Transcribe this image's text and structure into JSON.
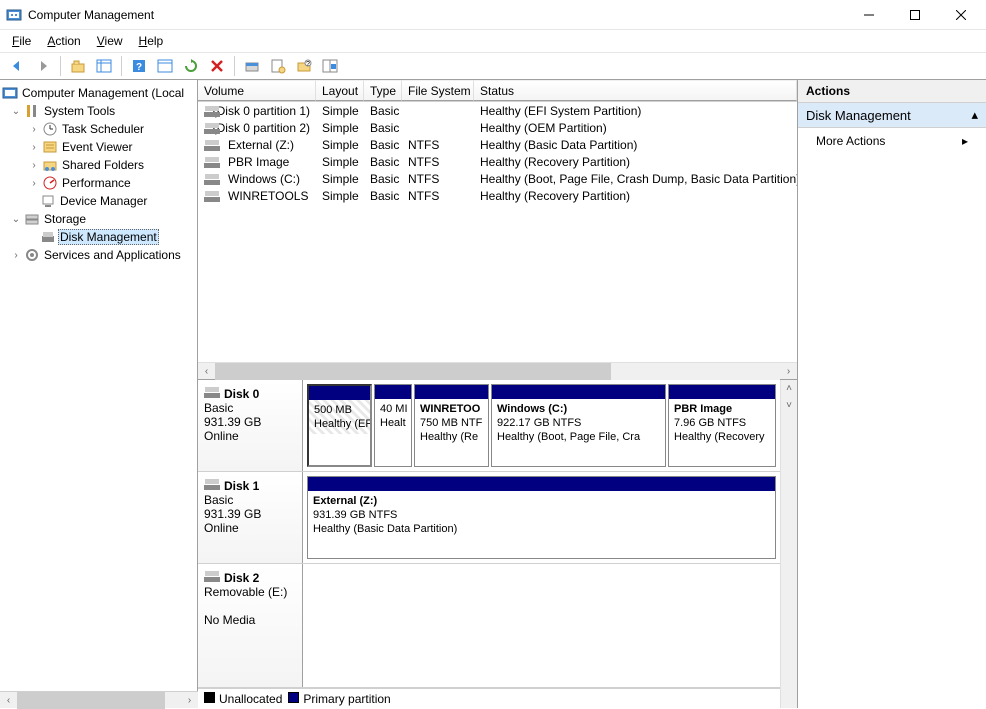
{
  "window": {
    "title": "Computer Management"
  },
  "menu": {
    "file": "File",
    "action": "Action",
    "view": "View",
    "help": "Help"
  },
  "tree": {
    "root": "Computer Management (Local",
    "systools": "System Tools",
    "tasksched": "Task Scheduler",
    "eventvwr": "Event Viewer",
    "sharedfld": "Shared Folders",
    "perf": "Performance",
    "devmgr": "Device Manager",
    "storage": "Storage",
    "diskmgmt": "Disk Management",
    "services": "Services and Applications"
  },
  "columns": {
    "volume": "Volume",
    "layout": "Layout",
    "type": "Type",
    "fs": "File System",
    "status": "Status"
  },
  "volumes": [
    {
      "name": "(Disk 0 partition 1)",
      "layout": "Simple",
      "type": "Basic",
      "fs": "",
      "status": "Healthy (EFI System Partition)"
    },
    {
      "name": "(Disk 0 partition 2)",
      "layout": "Simple",
      "type": "Basic",
      "fs": "",
      "status": "Healthy (OEM Partition)"
    },
    {
      "name": "External (Z:)",
      "layout": "Simple",
      "type": "Basic",
      "fs": "NTFS",
      "status": "Healthy (Basic Data Partition)"
    },
    {
      "name": "PBR Image",
      "layout": "Simple",
      "type": "Basic",
      "fs": "NTFS",
      "status": "Healthy (Recovery Partition)"
    },
    {
      "name": "Windows (C:)",
      "layout": "Simple",
      "type": "Basic",
      "fs": "NTFS",
      "status": "Healthy (Boot, Page File, Crash Dump, Basic Data Partition)"
    },
    {
      "name": "WINRETOOLS",
      "layout": "Simple",
      "type": "Basic",
      "fs": "NTFS",
      "status": "Healthy (Recovery Partition)"
    }
  ],
  "disks": {
    "d0": {
      "name": "Disk 0",
      "type": "Basic",
      "size": "931.39 GB",
      "state": "Online",
      "p0": {
        "l1": "",
        "l2": "500 MB",
        "l3": "Healthy (EF"
      },
      "p1": {
        "l1": "",
        "l2": "40 MI",
        "l3": "Healt"
      },
      "p2": {
        "l1": "WINRETOO",
        "l2": "750 MB NTF",
        "l3": "Healthy (Re"
      },
      "p3": {
        "l1": "Windows  (C:)",
        "l2": "922.17 GB NTFS",
        "l3": "Healthy (Boot, Page File, Cra"
      },
      "p4": {
        "l1": "PBR Image",
        "l2": "7.96 GB NTFS",
        "l3": "Healthy (Recovery"
      }
    },
    "d1": {
      "name": "Disk 1",
      "type": "Basic",
      "size": "931.39 GB",
      "state": "Online",
      "p0": {
        "l1": "External  (Z:)",
        "l2": "931.39 GB NTFS",
        "l3": "Healthy (Basic Data Partition)"
      }
    },
    "d2": {
      "name": "Disk 2",
      "type": "Removable (E:)",
      "nomedia": "No Media"
    }
  },
  "legend": {
    "unalloc": "Unallocated",
    "primary": "Primary partition"
  },
  "actions": {
    "header": "Actions",
    "selected": "Disk Management",
    "more": "More Actions"
  }
}
